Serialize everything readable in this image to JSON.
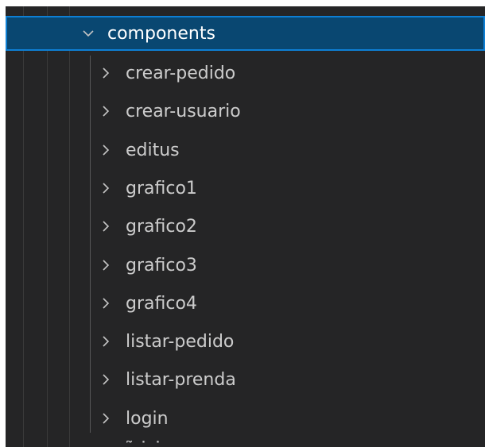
{
  "explorer": {
    "folder": {
      "name": "components",
      "expanded": true,
      "icon": "chevron-down-icon"
    },
    "children": [
      {
        "name": "crear-pedido",
        "icon": "chevron-right-icon"
      },
      {
        "name": "crear-usuario",
        "icon": "chevron-right-icon"
      },
      {
        "name": "editus",
        "icon": "chevron-right-icon"
      },
      {
        "name": "grafico1",
        "icon": "chevron-right-icon"
      },
      {
        "name": "grafico2",
        "icon": "chevron-right-icon"
      },
      {
        "name": "grafico3",
        "icon": "chevron-right-icon"
      },
      {
        "name": "grafico4",
        "icon": "chevron-right-icon"
      },
      {
        "name": "listar-pedido",
        "icon": "chevron-right-icon"
      },
      {
        "name": "listar-prenda",
        "icon": "chevron-right-icon"
      },
      {
        "name": "login",
        "icon": "chevron-right-icon"
      }
    ]
  },
  "colors": {
    "background": "#252526",
    "selection": "#094771",
    "selection_border": "#0e7fd4",
    "text": "#cccccc"
  }
}
